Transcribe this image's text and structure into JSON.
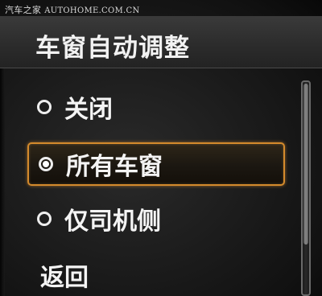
{
  "watermark": {
    "name": "汽车之家",
    "site": "AUTOHOME.COM.CN"
  },
  "menu": {
    "title": "车窗自动调整",
    "items": [
      {
        "label": "关闭",
        "selected": false,
        "focused": false
      },
      {
        "label": "所有车窗",
        "selected": true,
        "focused": true
      },
      {
        "label": "仅司机侧",
        "selected": false,
        "focused": false
      }
    ],
    "back_label": "返回"
  },
  "colors": {
    "focus_border": "#d48a2c",
    "text": "#f4f4f4",
    "background": "#1c1c1c"
  }
}
